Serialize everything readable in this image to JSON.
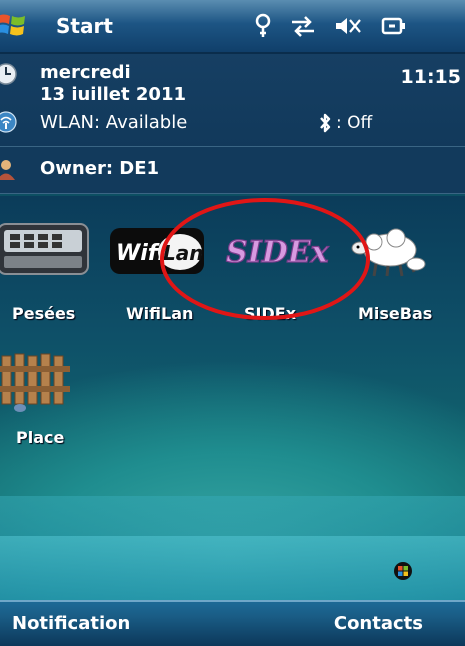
{
  "titlebar": {
    "title": "Start",
    "icons": [
      "start-flag-icon",
      "connectivity-icon",
      "data-sync-icon",
      "speaker-mute-icon",
      "battery-plug-icon"
    ]
  },
  "today": {
    "day": "mercredi",
    "date": "13 juillet 2011",
    "time": "11:15",
    "wlan": "WLAN: Available",
    "bluetooth": ": Off",
    "owner": "Owner: DE1"
  },
  "apps": [
    {
      "label": "Pesées",
      "icon": "scale-device-icon"
    },
    {
      "label": "WifiLan",
      "icon": "wifilan-logo-icon"
    },
    {
      "label": "SIDEx",
      "icon": "sidex-logo-icon"
    },
    {
      "label": "MiseBas",
      "icon": "sheep-icon"
    },
    {
      "label": "Place",
      "icon": "fence-icon"
    }
  ],
  "softkeys": {
    "left": "Notification",
    "right": "Contacts"
  },
  "colors": {
    "annotation_circle": "#e01616",
    "titlebar": "#1d5584",
    "desktop_teal": "#1f8d8f"
  }
}
